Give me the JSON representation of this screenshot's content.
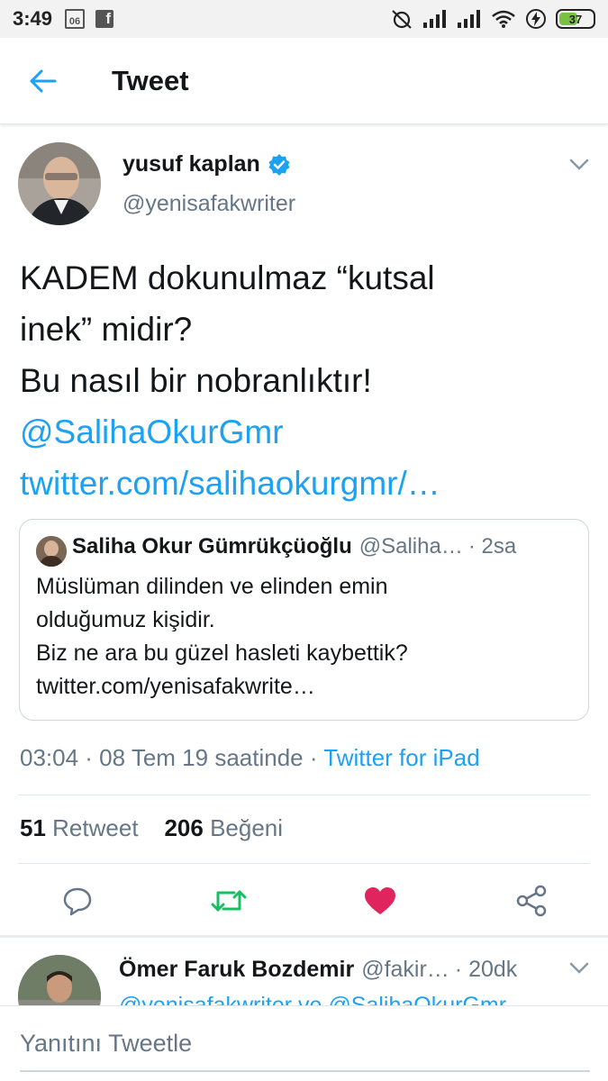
{
  "status_bar": {
    "time": "3:49",
    "left_icon_text": "06",
    "fb_text": "f",
    "battery": "37"
  },
  "header": {
    "title": "Tweet"
  },
  "tweet": {
    "name": "yusuf kaplan",
    "handle": "@yenisafakwriter",
    "text_lines": [
      "KADEM dokunulmaz “kutsal",
      "inek” midir?",
      "Bu nasıl bir nobranlıktır!"
    ],
    "mention": "@SalihaOkurGmr",
    "link": "twitter.com/salihaokurgmr/…",
    "meta_time": "03:04 · 08 Tem 19 saatinde · ",
    "meta_source": "Twitter for iPad",
    "retweet_count": "51",
    "retweet_label": "Retweet",
    "like_count": "206",
    "like_label": "Beğeni"
  },
  "quote": {
    "name": "Saliha Okur Gümrükçüoğlu",
    "handle": "@Saliha…",
    "time": "· 2sa",
    "lines": [
      "Müslüman dilinden ve elinden emin",
      "olduğumuz kişidir.",
      "Biz ne ara bu güzel hasleti kaybettik?",
      "twitter.com/yenisafakwrite…"
    ]
  },
  "reply": {
    "name": "Ömer Faruk Bozdemir",
    "handle": "@fakir…",
    "time": "· 20dk",
    "text": "@yenisafakwriter ve @SalihaOkurGmr"
  },
  "compose": {
    "placeholder": "Yanıtını Tweetle"
  },
  "colors": {
    "accent": "#1da1f2",
    "retweet": "#17bf63",
    "like": "#e0245e",
    "muted": "#657786"
  },
  "icons": {
    "back": "arrow-left-icon",
    "verified": "verified-badge-icon",
    "caret": "chevron-down-icon",
    "reply": "reply-icon",
    "retweet": "retweet-icon",
    "like": "heart-icon",
    "share": "share-icon"
  }
}
